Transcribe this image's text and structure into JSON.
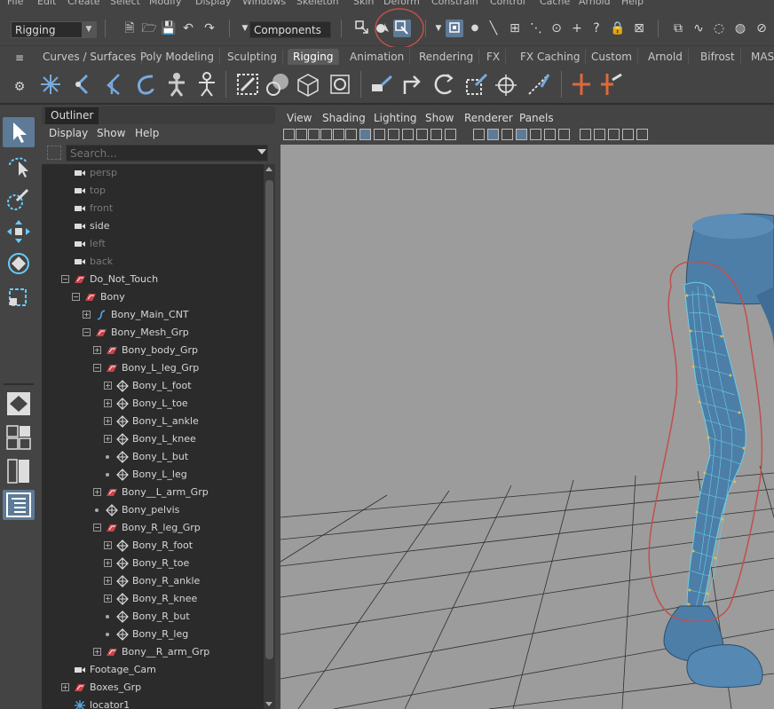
{
  "menubar": {
    "items": [
      "File",
      "Edit",
      "Create",
      "Select",
      "Modify",
      "Display",
      "Windows",
      "Skeleton",
      "Skin",
      "Deform",
      "Constrain",
      "Control",
      "Cache",
      "Arnold",
      "Help"
    ]
  },
  "statusline": {
    "mode_menu": "Rigging",
    "select_mode": "Components"
  },
  "shelf": {
    "tabs": [
      "Curves / Surfaces",
      "Poly Modeling",
      "Sculpting",
      "Rigging",
      "Animation",
      "Rendering",
      "FX",
      "FX Caching",
      "Custom",
      "Arnold",
      "Bifrost",
      "MASH"
    ],
    "active_tab": "Rigging"
  },
  "outliner": {
    "title": "Outliner",
    "menu": [
      "Display",
      "Show",
      "Help"
    ],
    "search_placeholder": "Search...",
    "items": [
      {
        "label": "persp",
        "type": "camera",
        "dim": true
      },
      {
        "label": "top",
        "type": "camera",
        "dim": true
      },
      {
        "label": "front",
        "type": "camera",
        "dim": true
      },
      {
        "label": "side",
        "type": "camera",
        "dim": false
      },
      {
        "label": "left",
        "type": "camera",
        "dim": true
      },
      {
        "label": "back",
        "type": "camera",
        "dim": true
      },
      {
        "label": "Do_Not_Touch",
        "type": "group",
        "expanded": true
      },
      {
        "label": "Bony",
        "type": "group",
        "expanded": true
      },
      {
        "label": "Bony_Main_CNT",
        "type": "curve",
        "expanded": false
      },
      {
        "label": "Bony_Mesh_Grp",
        "type": "group",
        "expanded": true
      },
      {
        "label": "Bony_body_Grp",
        "type": "group",
        "expanded": false
      },
      {
        "label": "Bony_L_leg_Grp",
        "type": "group",
        "expanded": true
      },
      {
        "label": "Bony_L_foot",
        "type": "mesh",
        "expanded": false
      },
      {
        "label": "Bony_L_toe",
        "type": "mesh",
        "expanded": false
      },
      {
        "label": "Bony_L_ankle",
        "type": "mesh",
        "expanded": false
      },
      {
        "label": "Bony_L_knee",
        "type": "mesh",
        "expanded": false
      },
      {
        "label": "Bony_L_but",
        "type": "mesh",
        "leaf": true
      },
      {
        "label": "Bony_L_leg",
        "type": "mesh",
        "leaf": true
      },
      {
        "label": "Bony__L_arm_Grp",
        "type": "group",
        "expanded": false
      },
      {
        "label": "Bony_pelvis",
        "type": "mesh",
        "leaf": true
      },
      {
        "label": "Bony_R_leg_Grp",
        "type": "group",
        "expanded": true
      },
      {
        "label": "Bony_R_foot",
        "type": "mesh",
        "expanded": false
      },
      {
        "label": "Bony_R_toe",
        "type": "mesh",
        "expanded": false
      },
      {
        "label": "Bony_R_ankle",
        "type": "mesh",
        "expanded": false
      },
      {
        "label": "Bony_R_knee",
        "type": "mesh",
        "expanded": false
      },
      {
        "label": "Bony_R_but",
        "type": "mesh",
        "leaf": true
      },
      {
        "label": "Bony_R_leg",
        "type": "mesh",
        "leaf": true
      },
      {
        "label": "Bony__R_arm_Grp",
        "type": "group",
        "expanded": false
      },
      {
        "label": "Footage_Cam",
        "type": "camera",
        "dim": false
      },
      {
        "label": "Boxes_Grp",
        "type": "group",
        "expanded": false
      },
      {
        "label": "locator1",
        "type": "locator"
      }
    ]
  },
  "viewport": {
    "menu": [
      "View",
      "Shading",
      "Lighting",
      "Show",
      "Renderer",
      "Panels"
    ]
  },
  "colors": {
    "accent_selected": "#5d7a96",
    "mesh_blue": "#4d7ea8",
    "annotation_red": "#c0504d",
    "grid_line": "#2a2a2a"
  }
}
